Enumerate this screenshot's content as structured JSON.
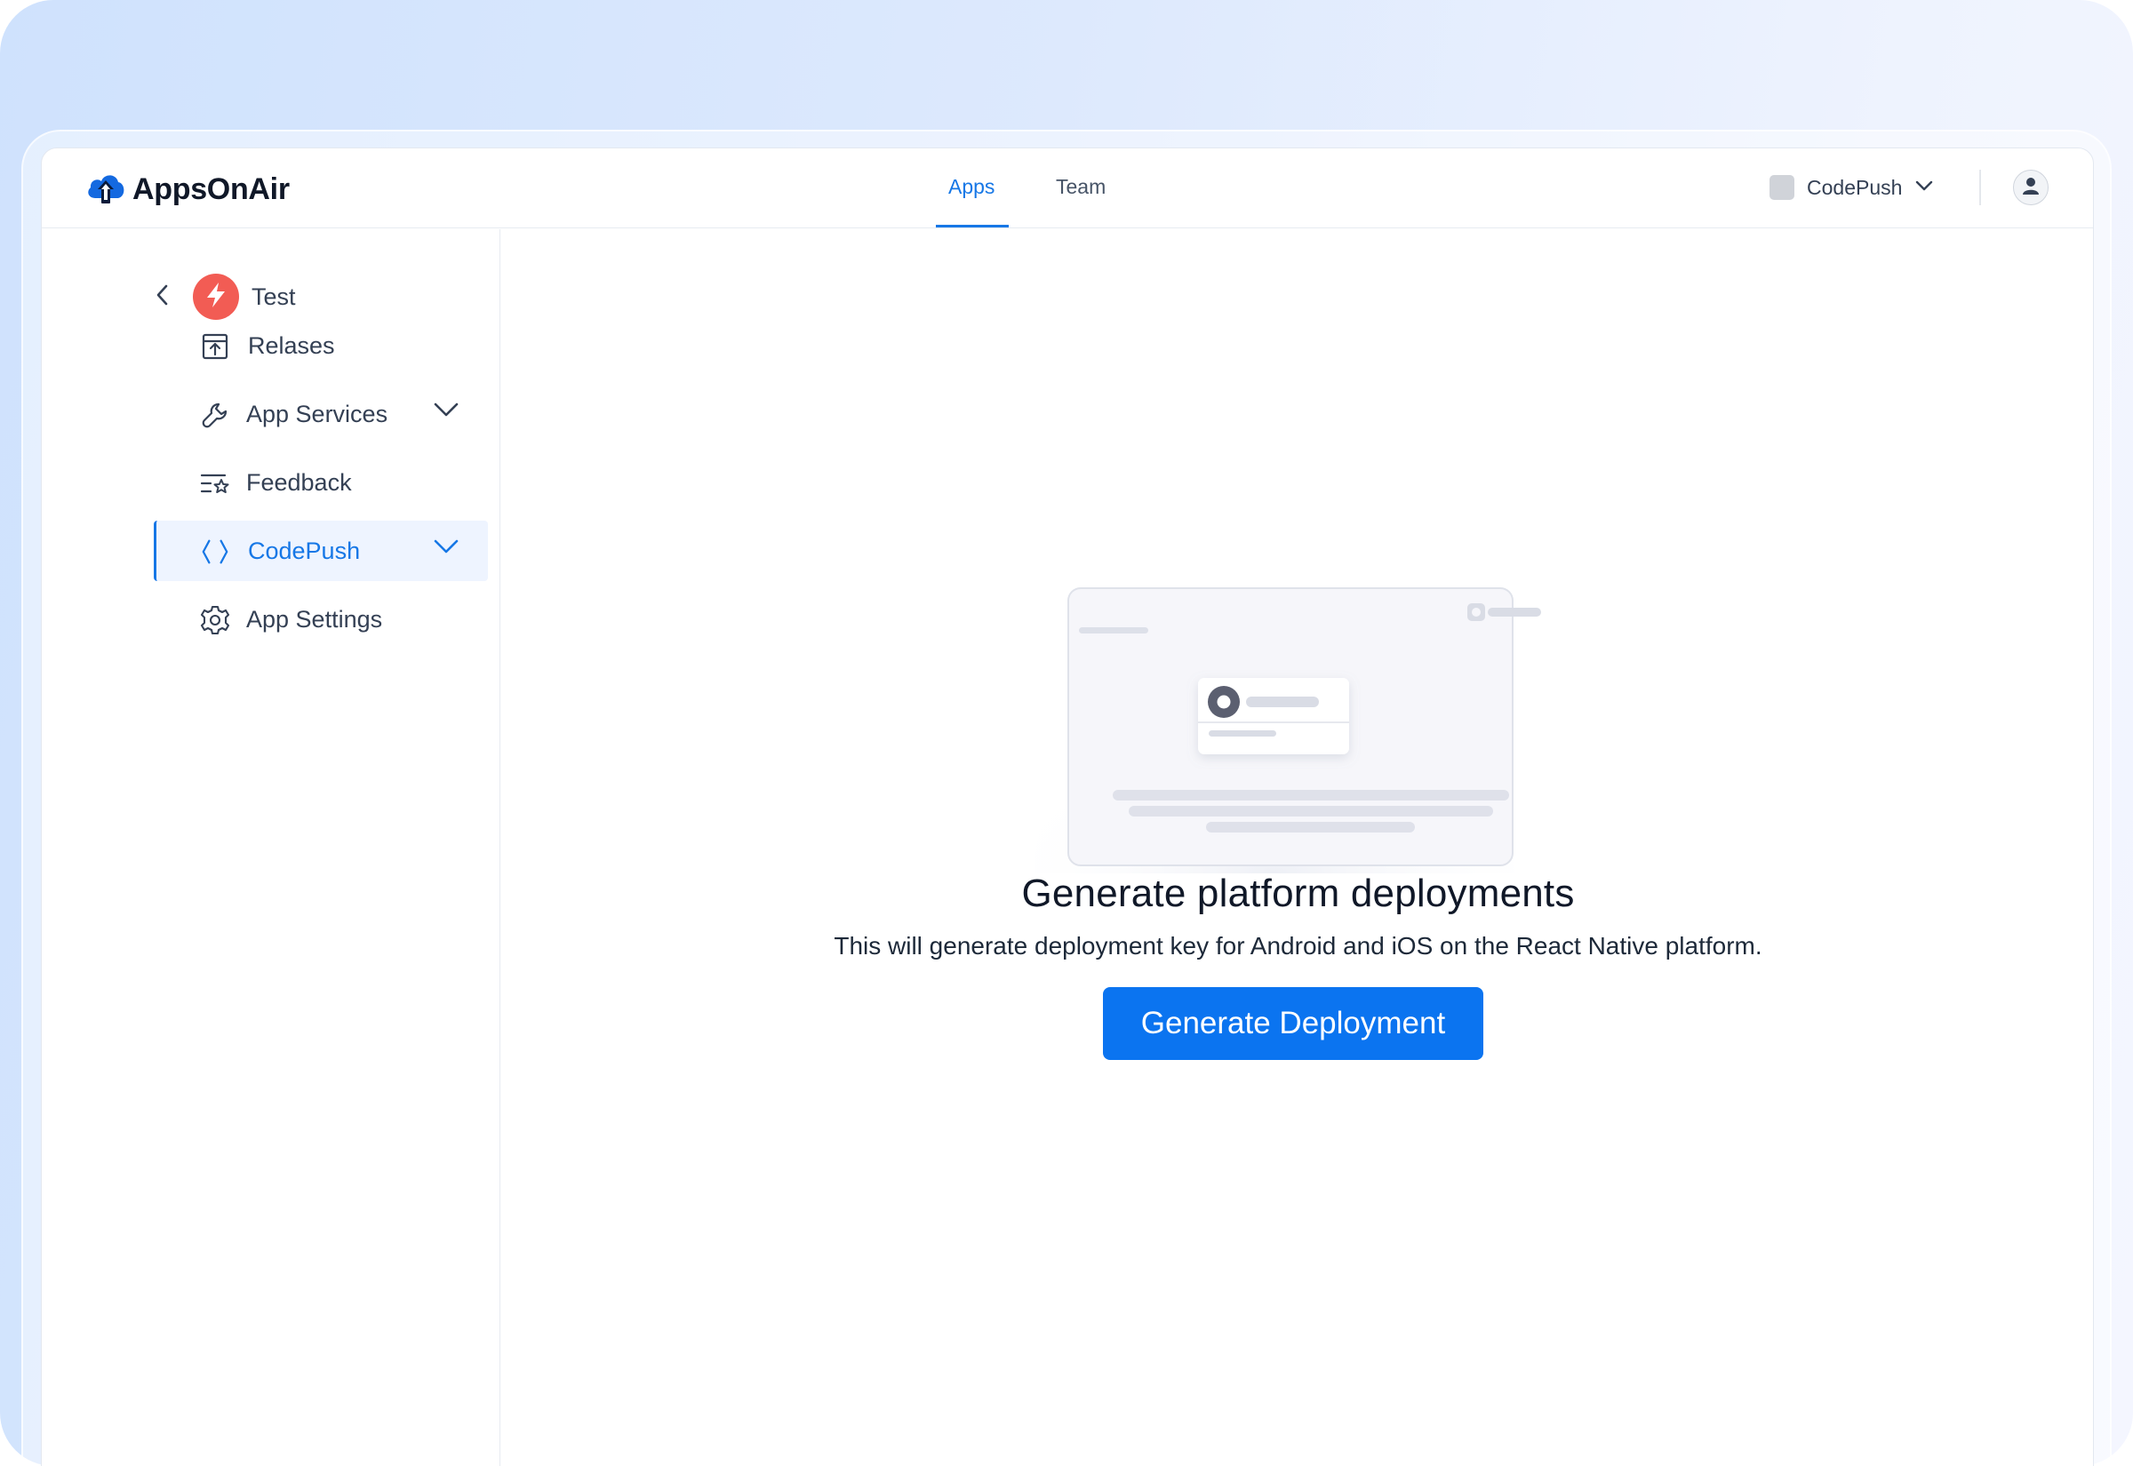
{
  "header": {
    "brand": "AppsOnAir",
    "tabs": [
      {
        "label": "Apps",
        "active": true
      },
      {
        "label": "Team",
        "active": false
      }
    ],
    "project_selector": {
      "label": "CodePush",
      "icon": "chevron-down-icon"
    },
    "avatar_icon": "user-icon"
  },
  "sidebar": {
    "app": {
      "name": "Test",
      "back_icon": "chevron-left-icon",
      "badge_icon": "bolt-icon",
      "badge_color": "#f25c54"
    },
    "items": [
      {
        "label": "Relases",
        "icon": "upload-box-icon",
        "expandable": false,
        "active": false
      },
      {
        "label": "App Services",
        "icon": "wrench-icon",
        "expandable": true,
        "active": false
      },
      {
        "label": "Feedback",
        "icon": "list-star-icon",
        "expandable": false,
        "active": false
      },
      {
        "label": "CodePush",
        "icon": "code-brackets-icon",
        "expandable": true,
        "active": true
      },
      {
        "label": "App Settings",
        "icon": "gear-icon",
        "expandable": false,
        "active": false
      }
    ]
  },
  "main": {
    "empty_state": {
      "title": "Generate platform deployments",
      "description": "This will generate deployment key for Android and iOS on the React Native platform.",
      "button_label": "Generate Deployment"
    }
  },
  "colors": {
    "accent": "#1677e6",
    "button": "#0b74f0",
    "active_bg": "#eef4ff"
  }
}
